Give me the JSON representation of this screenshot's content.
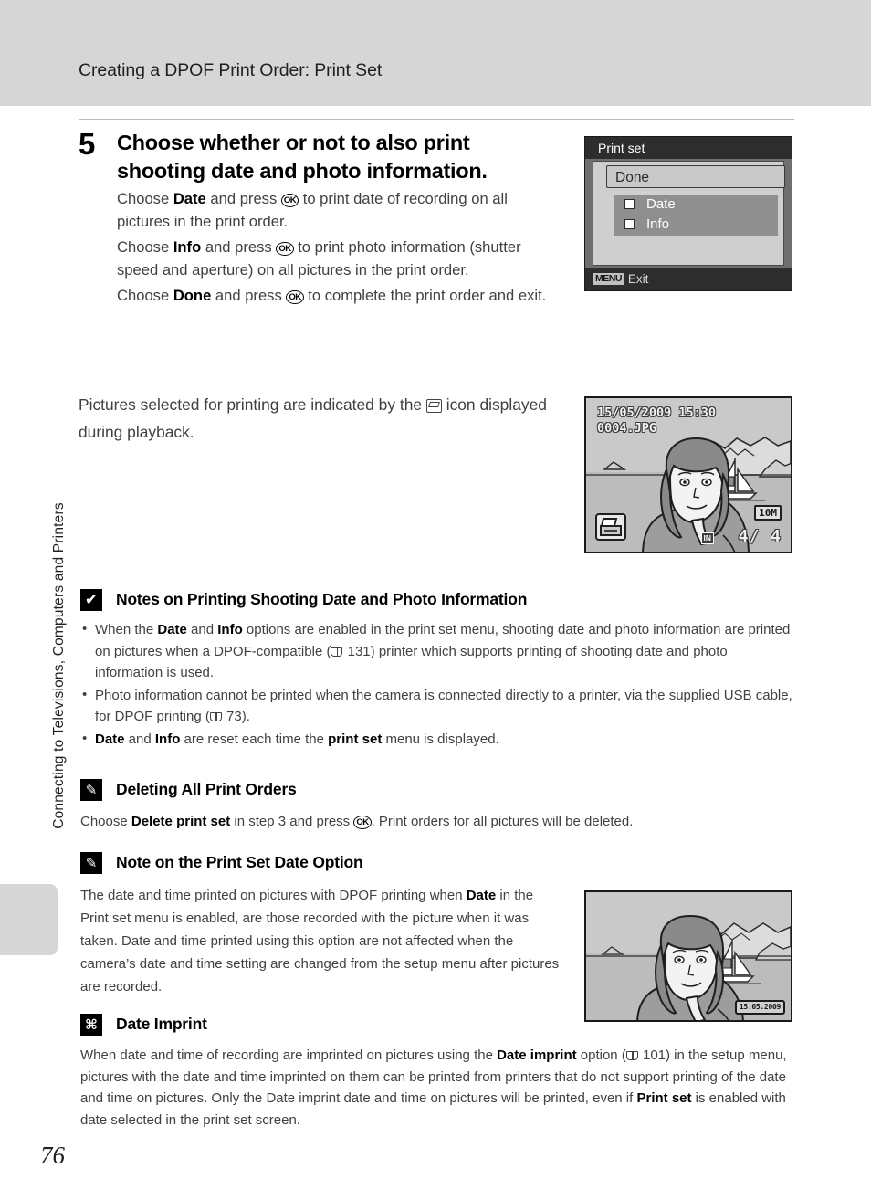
{
  "header": {
    "title": "Creating a DPOF Print Order: Print Set"
  },
  "side": {
    "running_head": "Connecting to Televisions, Computers and Printers"
  },
  "page": {
    "number": "76"
  },
  "step": {
    "number": "5",
    "heading": "Choose whether or not to also print shooting date and photo information.",
    "para1_a": "Choose ",
    "para1_b": "Date",
    "para1_c": " and press ",
    "para1_d": " to print date of recording on all pictures in the print order.",
    "para2_a": "Choose ",
    "para2_b": "Info",
    "para2_c": " and press ",
    "para2_d": " to print photo information (shutter speed and aperture) on all pictures in the print order.",
    "para3_a": "Choose ",
    "para3_b": "Done",
    "para3_c": " and press ",
    "para3_d": " to complete the print order and exit."
  },
  "mid_paragraph": {
    "text_a": "Pictures selected for printing are indicated by the ",
    "text_b": " icon displayed during playback."
  },
  "camera_menu": {
    "title": "Print set",
    "done_label": "Done",
    "options": [
      {
        "label": "Date",
        "checked": false
      },
      {
        "label": "Info",
        "checked": false
      }
    ],
    "footer_key": "MENU",
    "footer_label": "Exit"
  },
  "playback_screen": {
    "datetime": "15/05/2009 15:30",
    "filename": "0004.JPG",
    "print_icon": "print-order-icon",
    "memory_badge": "IN",
    "counter": "4/  4",
    "image_size": "10M"
  },
  "date_imprint_screen": {
    "datestamp": "15.05.2009"
  },
  "notes": [
    {
      "icon": "caution-checkmark-icon",
      "icon_glyph": "✔",
      "title": "Notes on Printing Shooting Date and Photo Information",
      "bullets": [
        {
          "a": "When the ",
          "b1": "Date",
          "c": " and ",
          "b2": "Info",
          "d": " options are enabled in the print set menu, shooting date and photo information are printed on pictures when a DPOF-compatible (",
          "ref": "131",
          "e": ") printer which supports printing of shooting date and photo information is used."
        },
        {
          "a": "Photo information cannot be printed when the camera is connected directly to a printer, via the supplied USB cable, for DPOF printing (",
          "ref": "73",
          "e": ")."
        },
        {
          "b1": "Date",
          "c": " and ",
          "b2": "Info",
          "d": " are reset each time the ",
          "b3": "print set",
          "e": " menu is displayed."
        }
      ]
    },
    {
      "icon": "pencil-note-icon",
      "icon_glyph": "✎",
      "title": "Deleting All Print Orders",
      "body_a": "Choose ",
      "body_b": "Delete print set",
      "body_c": " in step 3 and press ",
      "body_d": ". Print orders for all pictures will be deleted."
    },
    {
      "icon": "pencil-note-icon",
      "icon_glyph": "✎",
      "title": "Note on the Print Set Date Option",
      "body_a": "The date and time printed on pictures with DPOF printing when ",
      "body_b": "Date",
      "body_c": " in the Print set menu is enabled, are those recorded with the picture when it was taken. Date and time printed using this option are not affected when the camera’s date and time setting are changed from the setup menu after pictures are recorded."
    },
    {
      "icon": "date-imprint-icon",
      "icon_glyph": "⌘",
      "title": "Date Imprint",
      "body_a": "When date and time of recording are imprinted on pictures using the ",
      "body_b": "Date imprint",
      "body_c": " option (",
      "ref": "101",
      "body_d": ") in the setup menu, pictures with the date and time imprinted on them can be printed from printers that do not support printing of the date and time on pictures. Only the Date imprint date and time on pictures will be printed, even if ",
      "body_e": "Print set",
      "body_f": " is enabled with date selected in the print set screen."
    }
  ]
}
